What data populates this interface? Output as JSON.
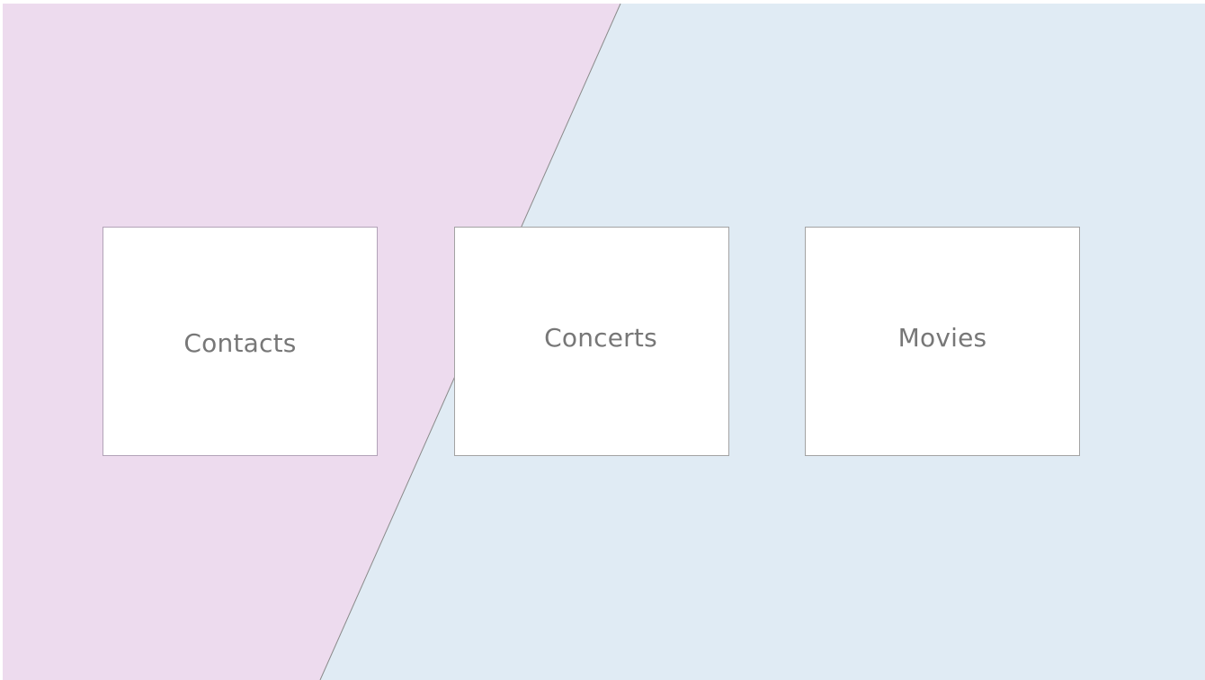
{
  "background": {
    "left_panel_color": "#eddbee",
    "right_panel_color": "#e0ebf4",
    "divider_color": "#8a8a8a"
  },
  "tiles": [
    {
      "label": "Contacts"
    },
    {
      "label": "Concerts"
    },
    {
      "label": "Movies"
    }
  ]
}
